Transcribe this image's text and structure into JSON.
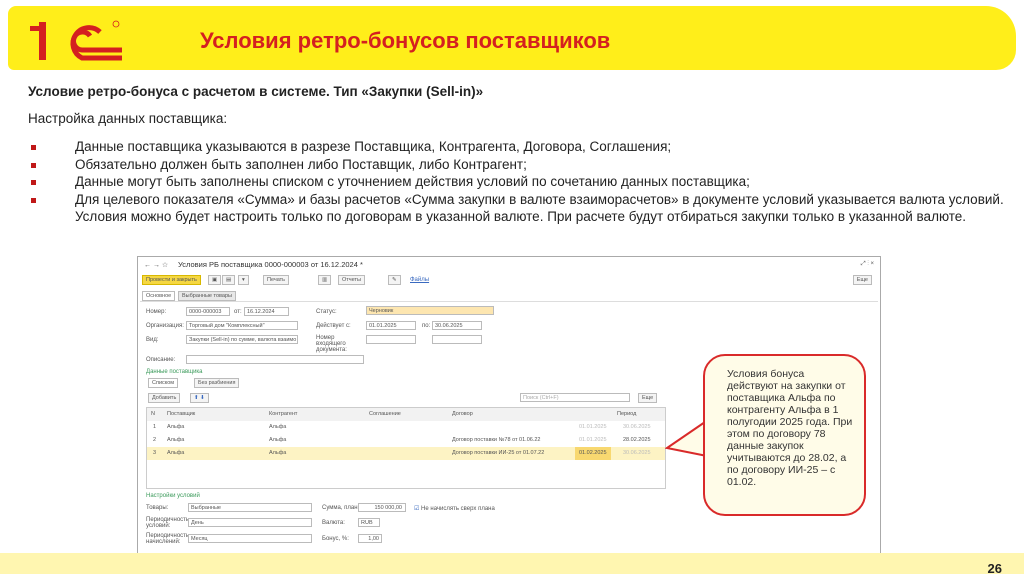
{
  "header": {
    "logo_text": "1С",
    "title": "Условия ретро-бонусов поставщиков"
  },
  "subtitle": "Условие ретро-бонуса с расчетом в системе. Тип «Закупки (Sell-in)»",
  "lead": "Настройка данных поставщика:",
  "bullets": [
    "Данные поставщика указываются в разрезе Поставщика, Контрагента, Договора, Соглашения;",
    "Обязательно должен быть заполнен либо Поставщик, либо Контрагент;",
    "Данные могут быть заполнены списком с уточнением действия условий по сочетанию данных поставщика;",
    "Для целевого показателя «Сумма» и базы расчетов «Сумма закупки в валюте взаиморасчетов» в документе условий указывается валюта условий. Условия можно будет настроить только по договорам в указанной валюте. При расчете будут отбираться закупки только в указанной валюте."
  ],
  "window": {
    "title": "Условия РБ поставщика 0000-000003 от 16.12.2024 *",
    "post_close": "Провести и закрыть",
    "print": "Печать",
    "reports": "Отчеты",
    "files": "Файлы",
    "more": "Еще",
    "tabs": [
      "Основное",
      "Выбранные товары"
    ],
    "number_label": "Номер:",
    "number": "0000-000003",
    "from_label": "от:",
    "date": "16.12.2024",
    "status_label": "Статус:",
    "status": "Черновик",
    "org_label": "Организация:",
    "org": "Торговый дом \"Комплексный\"",
    "valid_label": "Действует с:",
    "valid_from": "01.01.2025",
    "to_label": "по:",
    "valid_to": "30.06.2025",
    "kind_label": "Вид:",
    "kind": "Закупки (Sell-in) по сумме, валюта взаимо",
    "incoming_label": "Номер входящего документа:",
    "desc_label": "Описание:",
    "supplier_section": "Данные поставщика",
    "mode_list": "Списком",
    "mode_none": "Без разбиения",
    "add": "Добавить",
    "search_placeholder": "Поиск (Ctrl+F)",
    "columns": [
      "N",
      "Поставщик",
      "Контрагент",
      "Соглашение",
      "Договор",
      "Период"
    ],
    "rows": [
      {
        "n": "1",
        "supplier": "Альфа",
        "counterparty": "Альфа",
        "contract": "",
        "from": "01.01.2025",
        "to": "30.06.2025"
      },
      {
        "n": "2",
        "supplier": "Альфа",
        "counterparty": "Альфа",
        "contract": "Договор поставки №78 от 01.06.22",
        "from": "01.01.2025",
        "to": "28.02.2025"
      },
      {
        "n": "3",
        "supplier": "Альфа",
        "counterparty": "Альфа",
        "contract": "Договор поставки ИИ-25 от 01.07.22",
        "from": "01.02.2025",
        "to": "30.06.2025"
      }
    ],
    "settings_section": "Настройки условий",
    "goods_label": "Товары:",
    "goods": "Выбранные",
    "sum_label": "Сумма, план:",
    "sum": "150 000,00",
    "no_over": "Не начислять сверх плана",
    "period_cond_label": "Периодичность условий:",
    "period_cond": "День",
    "currency_label": "Валюта:",
    "currency": "RUB",
    "period_acc_label": "Периодичность начислений:",
    "period_acc": "Месяц",
    "bonus_label": "Бонус, %:",
    "bonus": "1,00"
  },
  "callout": {
    "text": "Условия бонуса действуют на закупки от поставщика Альфа по контрагенту Альфа в 1 полугодии 2025 года. При этом по договору 78 данные закупок учитываются до 28.02, а по договору ИИ-25 – с 01.02."
  },
  "page_number": "26",
  "colors": {
    "accent": "#d42020",
    "banner": "#ffee1a",
    "callout_border": "#d92a2a"
  }
}
